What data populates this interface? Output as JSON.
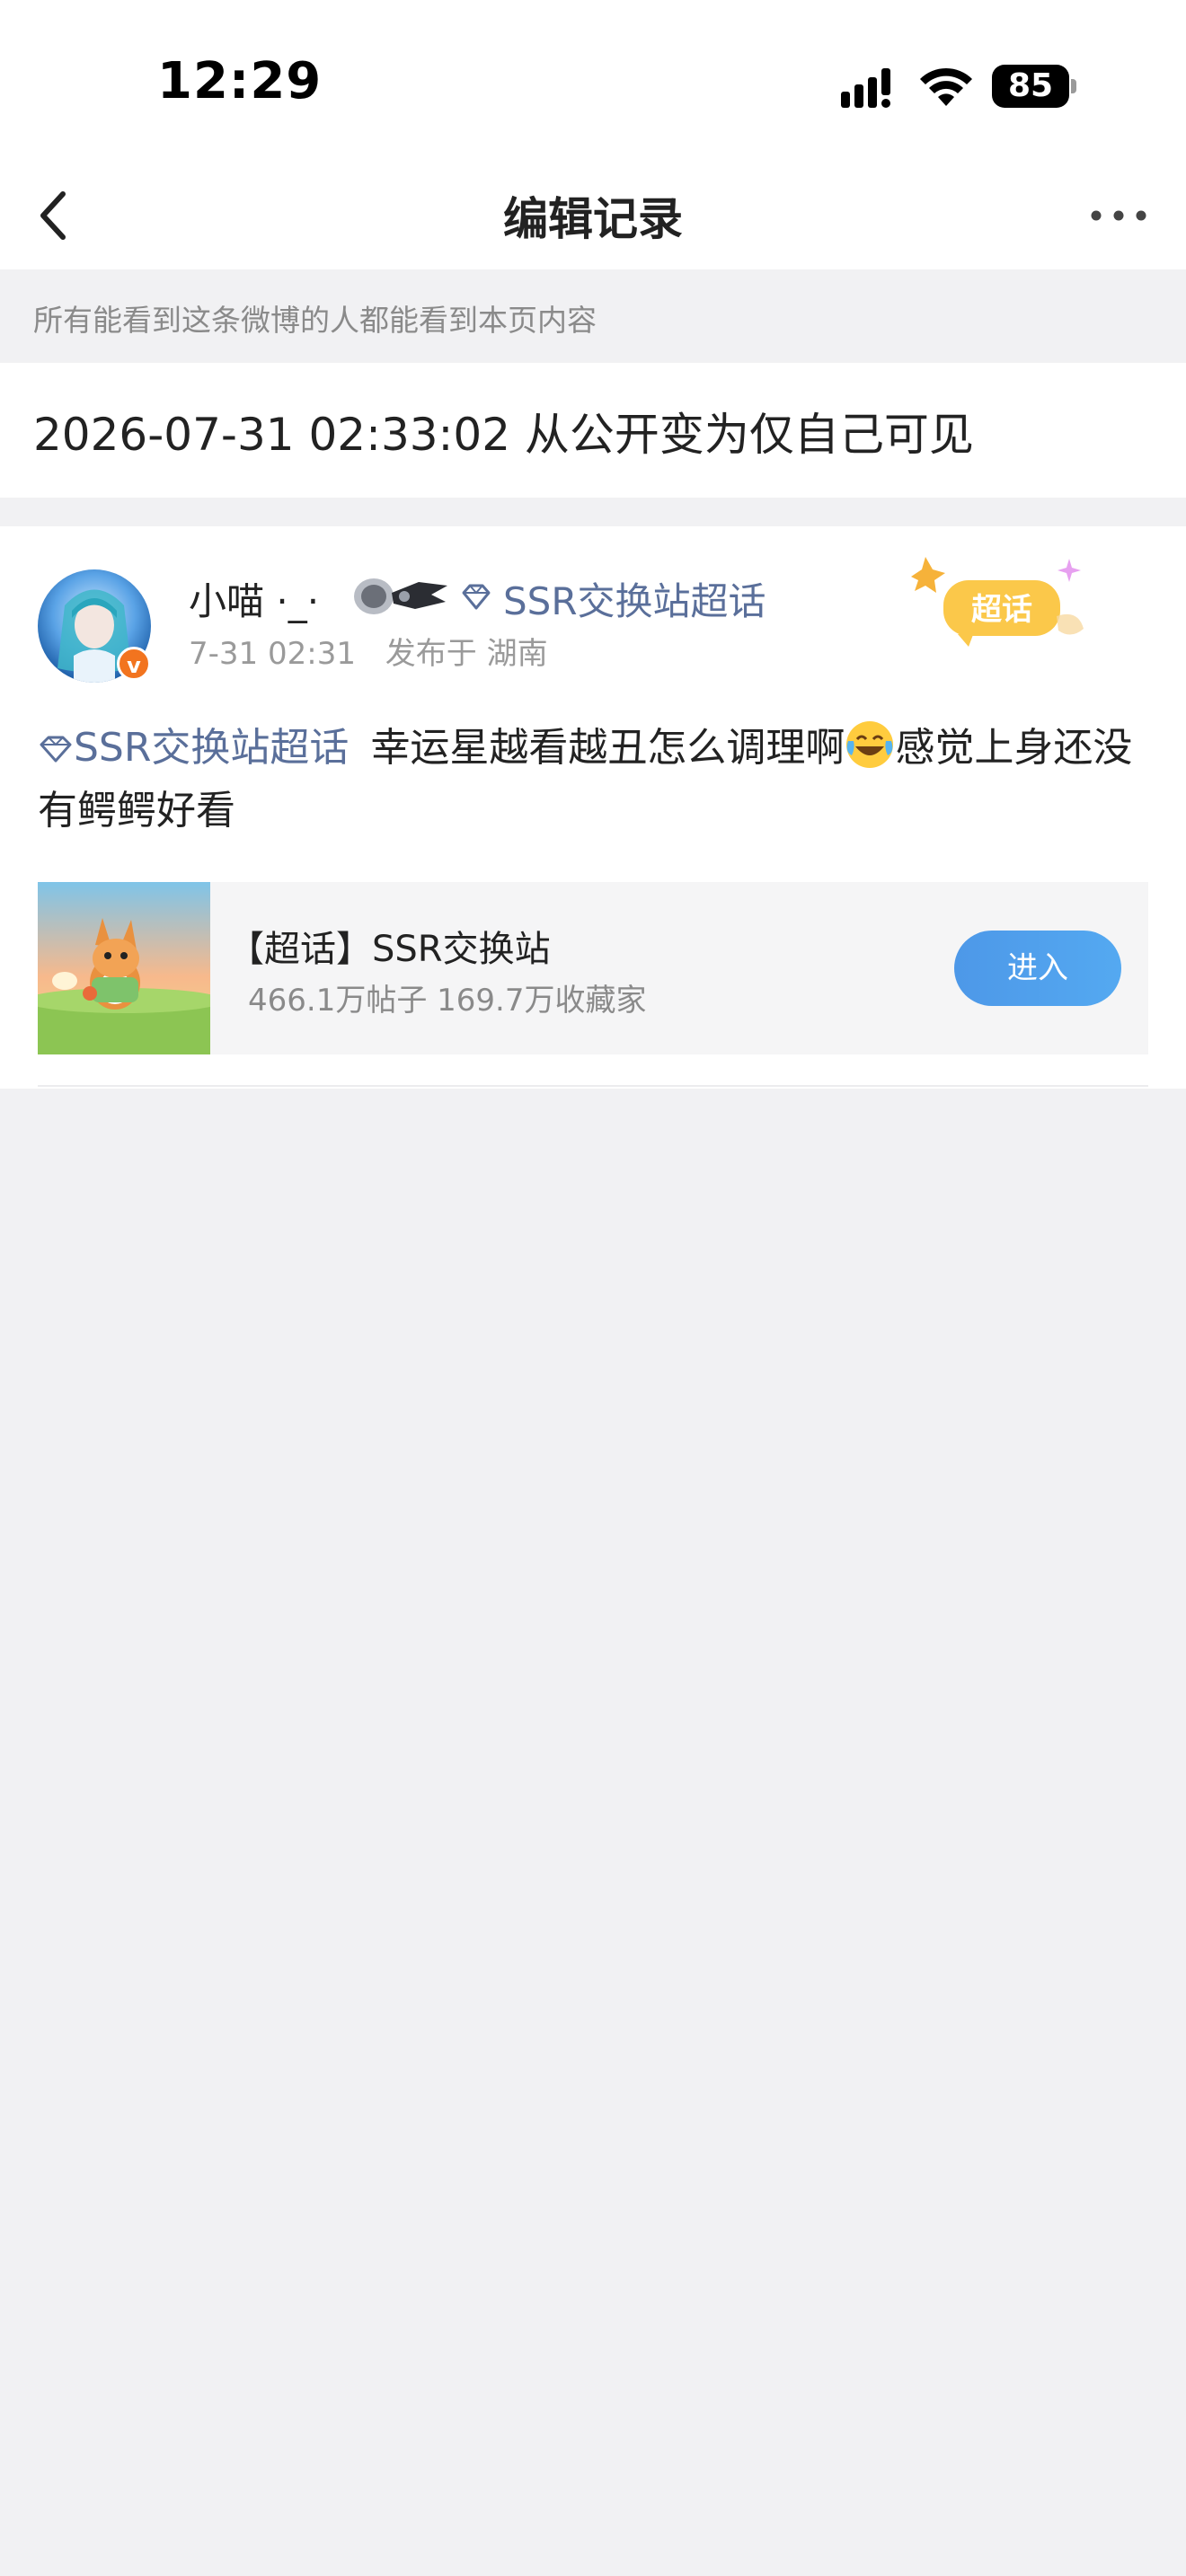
{
  "status_bar": {
    "time": "12:29",
    "battery": "85"
  },
  "nav": {
    "title": "编辑记录"
  },
  "notice": "所有能看到这条微博的人都能看到本页内容",
  "edit_record": {
    "text": "2026-07-31 02:33:02 从公开变为仅自己可见"
  },
  "post": {
    "username": "小喵 ·_·",
    "topic_tag": "SSR交换站超话",
    "sticker_text": "超话",
    "time": "7-31 02:31",
    "location": "发布于 湖南",
    "body_topic": "SSR交换站超话",
    "body_text_1": "幸运星越看越丑怎么调理啊",
    "body_text_2": "感觉上身还没有鳄鳄好看",
    "verified_icon": "v"
  },
  "topic_card": {
    "title": "【超话】SSR交换站",
    "stats": "466.1万帖子 169.7万收藏家",
    "enter_label": "进入"
  },
  "colors": {
    "topic_link": "#5a6f9a",
    "enter_button": "#4d98e8",
    "verified_badge": "#f2741f",
    "page_background": "#f1f1f3"
  },
  "icons": [
    "back-arrow-icon",
    "more-dots-icon",
    "signal-icon",
    "wifi-icon",
    "battery-icon",
    "diamond-icon",
    "laughing-emoji-icon"
  ]
}
